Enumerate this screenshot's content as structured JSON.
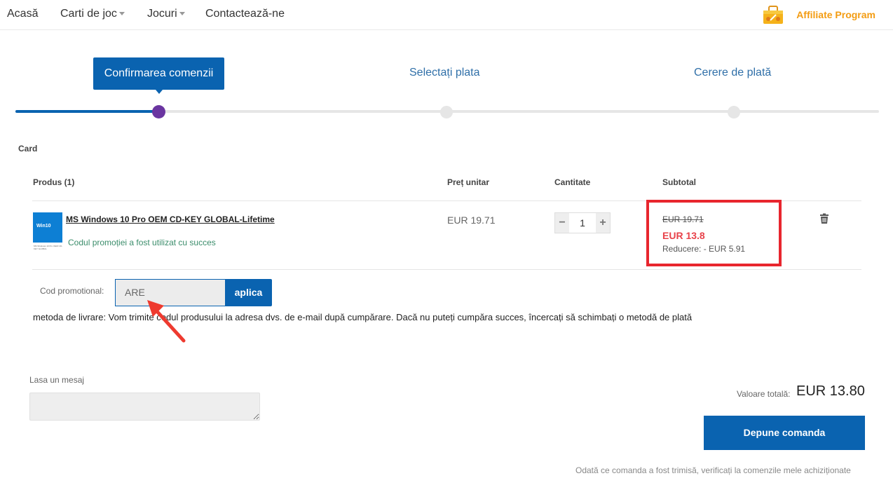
{
  "nav": {
    "items": [
      {
        "label": "Acasă"
      },
      {
        "label": "Carti de joc"
      },
      {
        "label": "Jocuri"
      },
      {
        "label": "Contactează-ne"
      }
    ],
    "affiliate_label": "Affiliate Program"
  },
  "steps": [
    {
      "label": "Confirmarea comenzii",
      "active": true
    },
    {
      "label": "Selectați plata",
      "active": false
    },
    {
      "label": "Cerere de plată",
      "active": false
    }
  ],
  "cart": {
    "title": "Card",
    "columns": {
      "product": "Produs (1)",
      "unit_price": "Preț unitar",
      "quantity": "Cantitate",
      "subtotal": "Subtotal"
    },
    "item": {
      "thumb_label": "Win10",
      "thumb_caption": "MS Windows 10 Pro OEM CD-KEY GLOBAL",
      "name": "MS Windows 10 Pro OEM CD-KEY GLOBAL-Lifetime",
      "promo_message": "Codul promoției a fost utilizat cu succes",
      "unit_price": "EUR 19.71",
      "quantity": "1",
      "old_price": "EUR 19.71",
      "new_price": "EUR 13.8",
      "discount": "Reducere: - EUR 5.91"
    }
  },
  "promo": {
    "label": "Cod promotional:",
    "value": "ARE",
    "apply_label": "aplica"
  },
  "delivery_text": "metoda de livrare: Vom trimite codul produsului la adresa dvs. de e-mail după cumpărare. Dacă nu puteți cumpăra succes, încercați să schimbați o metodă de plată",
  "message": {
    "label": "Lasa un mesaj",
    "value": ""
  },
  "total": {
    "label": "Valoare totală:",
    "value": "EUR 13.80"
  },
  "submit_label": "Depune comanda",
  "footer_note": "Odată ce comanda a fost trimisă, verificați la comenzile mele achiziționate",
  "colors": {
    "primary": "#0a63b0",
    "affiliate": "#f39c12",
    "discount_red": "#e8424a",
    "highlight_box": "#e8262e",
    "step_dot_active": "#6a35a0"
  }
}
